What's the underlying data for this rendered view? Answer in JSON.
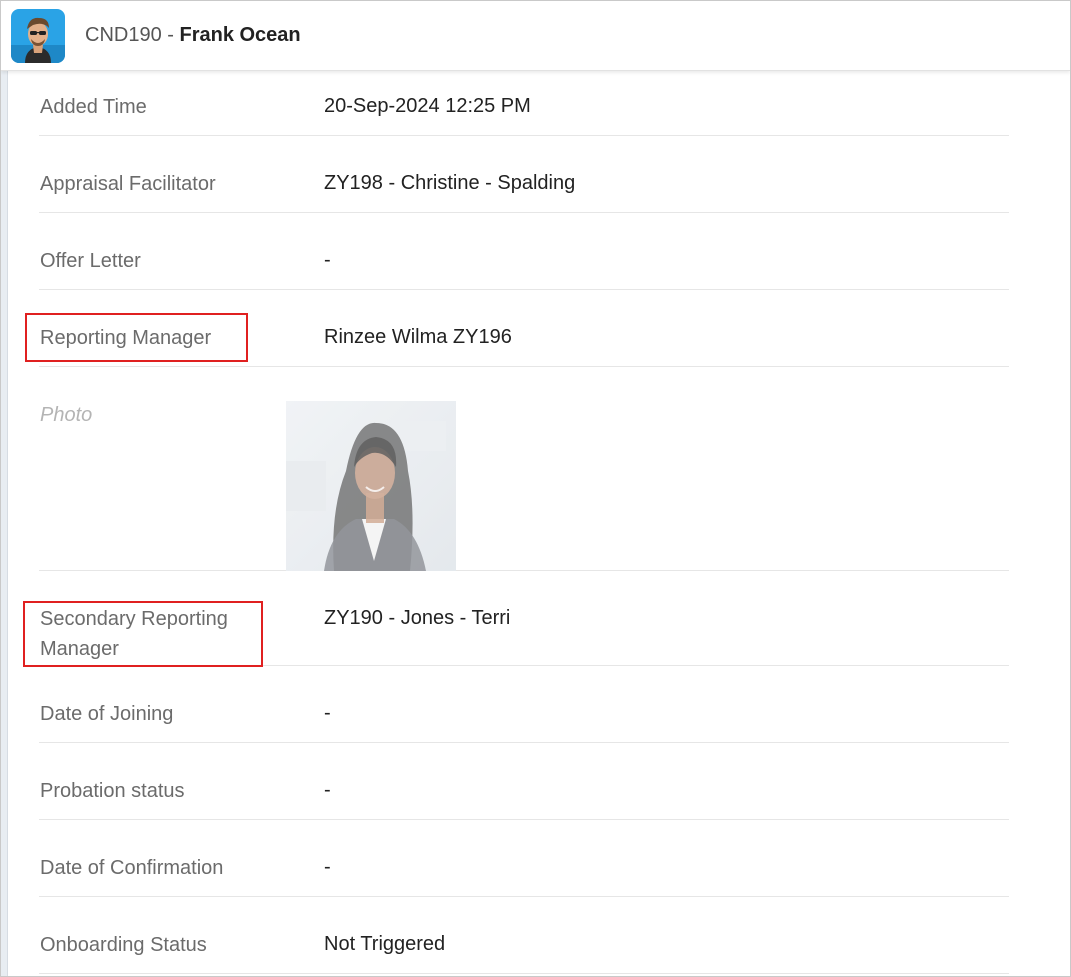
{
  "header": {
    "id": "CND190",
    "separator": " - ",
    "name": "Frank Ocean"
  },
  "fields": [
    {
      "label": "Added Time",
      "value": "20-Sep-2024 12:25 PM"
    },
    {
      "label": "Appraisal Facilitator",
      "value": "ZY198 - Christine - Spalding"
    },
    {
      "label": "Offer Letter",
      "value": "-"
    },
    {
      "label": "Reporting Manager",
      "value": "Rinzee Wilma ZY196"
    },
    {
      "label": "Photo",
      "value": ""
    },
    {
      "label": "Secondary Reporting Manager",
      "value": "ZY190 - Jones - Terri"
    },
    {
      "label": "Date of Joining",
      "value": "-"
    },
    {
      "label": "Probation status",
      "value": "-"
    },
    {
      "label": "Date of Confirmation",
      "value": "-"
    },
    {
      "label": "Onboarding Status",
      "value": "Not Triggered"
    }
  ],
  "colors": {
    "highlight": "#e02020",
    "avatar_bg": "#2aa3e6"
  },
  "icons": {
    "header_avatar": "avatar-icon",
    "photo": "person-photo"
  }
}
